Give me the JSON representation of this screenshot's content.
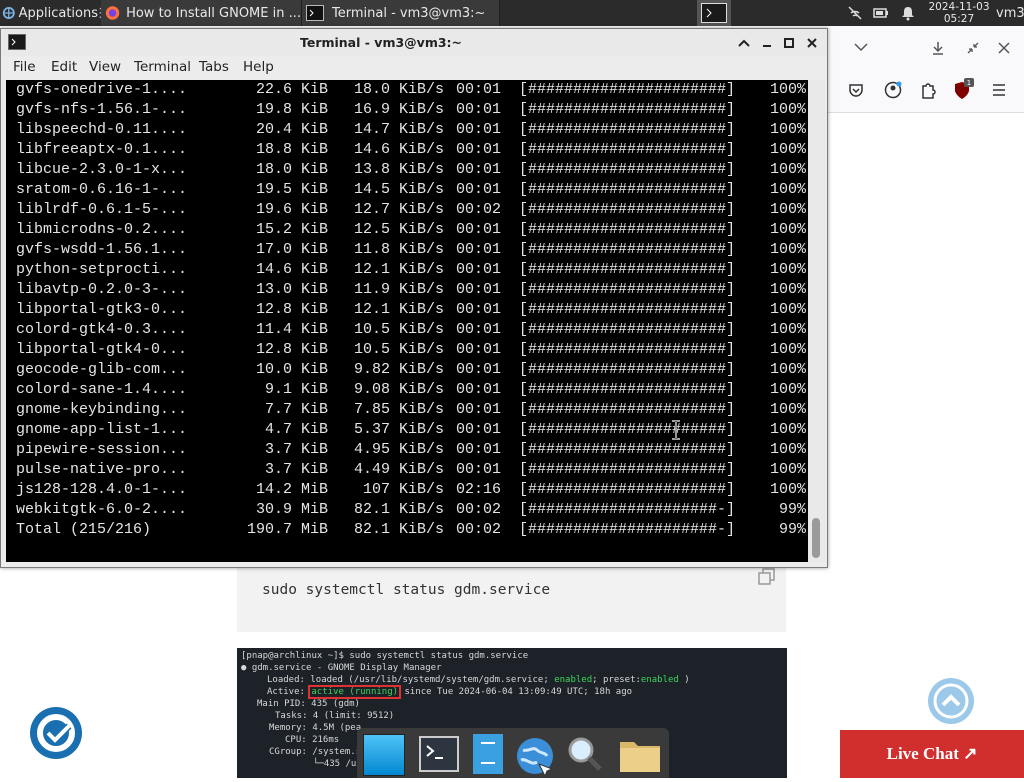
{
  "top_panel": {
    "applications_label": "Applications",
    "tasks": [
      {
        "label": "How to Install GNOME in ...",
        "icon": "firefox-icon"
      },
      {
        "label": "Terminal - vm3@vm3:~",
        "icon": "terminal-icon"
      }
    ],
    "clock_date": "2024-11-03",
    "clock_time": "05:27",
    "user": "vm3"
  },
  "terminal": {
    "title": "Terminal - vm3@vm3:~",
    "menu": [
      "File",
      "Edit",
      "View",
      "Terminal",
      "Tabs",
      "Help"
    ],
    "rows": [
      {
        "name": "gvfs-onedrive-1....",
        "size": "22.6 KiB",
        "speed": "18.0 KiB/s",
        "time": "00:01",
        "bar": "[######################]",
        "pct": "100%"
      },
      {
        "name": "gvfs-nfs-1.56.1-...",
        "size": "19.8 KiB",
        "speed": "16.9 KiB/s",
        "time": "00:01",
        "bar": "[######################]",
        "pct": "100%"
      },
      {
        "name": "libspeechd-0.11....",
        "size": "20.4 KiB",
        "speed": "14.7 KiB/s",
        "time": "00:01",
        "bar": "[######################]",
        "pct": "100%"
      },
      {
        "name": "libfreeaptx-0.1....",
        "size": "18.8 KiB",
        "speed": "14.6 KiB/s",
        "time": "00:01",
        "bar": "[######################]",
        "pct": "100%"
      },
      {
        "name": "libcue-2.3.0-1-x...",
        "size": "18.0 KiB",
        "speed": "13.8 KiB/s",
        "time": "00:01",
        "bar": "[######################]",
        "pct": "100%"
      },
      {
        "name": "sratom-0.6.16-1-...",
        "size": "19.5 KiB",
        "speed": "14.5 KiB/s",
        "time": "00:01",
        "bar": "[######################]",
        "pct": "100%"
      },
      {
        "name": "liblrdf-0.6.1-5-...",
        "size": "19.6 KiB",
        "speed": "12.7 KiB/s",
        "time": "00:02",
        "bar": "[######################]",
        "pct": "100%"
      },
      {
        "name": "libmicrodns-0.2....",
        "size": "15.2 KiB",
        "speed": "12.5 KiB/s",
        "time": "00:01",
        "bar": "[######################]",
        "pct": "100%"
      },
      {
        "name": "gvfs-wsdd-1.56.1...",
        "size": "17.0 KiB",
        "speed": "11.8 KiB/s",
        "time": "00:01",
        "bar": "[######################]",
        "pct": "100%"
      },
      {
        "name": "python-setprocti...",
        "size": "14.6 KiB",
        "speed": "12.1 KiB/s",
        "time": "00:01",
        "bar": "[######################]",
        "pct": "100%"
      },
      {
        "name": "libavtp-0.2.0-3-...",
        "size": "13.0 KiB",
        "speed": "11.9 KiB/s",
        "time": "00:01",
        "bar": "[######################]",
        "pct": "100%"
      },
      {
        "name": "libportal-gtk3-0...",
        "size": "12.8 KiB",
        "speed": "12.1 KiB/s",
        "time": "00:01",
        "bar": "[######################]",
        "pct": "100%"
      },
      {
        "name": "colord-gtk4-0.3....",
        "size": "11.4 KiB",
        "speed": "10.5 KiB/s",
        "time": "00:01",
        "bar": "[######################]",
        "pct": "100%"
      },
      {
        "name": "libportal-gtk4-0...",
        "size": "12.8 KiB",
        "speed": "10.5 KiB/s",
        "time": "00:01",
        "bar": "[######################]",
        "pct": "100%"
      },
      {
        "name": "geocode-glib-com...",
        "size": "10.0 KiB",
        "speed": "9.82 KiB/s",
        "time": "00:01",
        "bar": "[######################]",
        "pct": "100%"
      },
      {
        "name": "colord-sane-1.4....",
        "size": "9.1 KiB",
        "speed": "9.08 KiB/s",
        "time": "00:01",
        "bar": "[######################]",
        "pct": "100%"
      },
      {
        "name": "gnome-keybinding...",
        "size": "7.7 KiB",
        "speed": "7.85 KiB/s",
        "time": "00:01",
        "bar": "[######################]",
        "pct": "100%"
      },
      {
        "name": "gnome-app-list-1...",
        "size": "4.7 KiB",
        "speed": "5.37 KiB/s",
        "time": "00:01",
        "bar": "[######################]",
        "pct": "100%"
      },
      {
        "name": "pipewire-session...",
        "size": "3.7 KiB",
        "speed": "4.95 KiB/s",
        "time": "00:01",
        "bar": "[######################]",
        "pct": "100%"
      },
      {
        "name": "pulse-native-pro...",
        "size": "3.7 KiB",
        "speed": "4.49 KiB/s",
        "time": "00:01",
        "bar": "[######################]",
        "pct": "100%"
      },
      {
        "name": "js128-128.4.0-1-...",
        "size": "14.2 MiB",
        "speed": "107 KiB/s",
        "time": "02:16",
        "bar": "[######################]",
        "pct": "100%"
      },
      {
        "name": "webkitgtk-6.0-2....",
        "size": "30.9 MiB",
        "speed": "82.1 KiB/s",
        "time": "00:02",
        "bar": "[#####################-]",
        "pct": "99%"
      },
      {
        "name": "Total (215/216)",
        "size": "190.7 MiB",
        "speed": "82.1 KiB/s",
        "time": "00:02",
        "bar": "[#####################-]",
        "pct": "99%"
      }
    ]
  },
  "page": {
    "code_command": "sudo systemctl status gdm.service",
    "snippet": {
      "prompt": "[pnap@archlinux ~]$ sudo systemctl status gdm.service",
      "unit": "● gdm.service - GNOME Display Manager",
      "loaded_label": "Loaded:",
      "loaded_value": "loaded (/usr/lib/systemd/system/gdm.service;",
      "loaded_enabled": "enabled",
      "loaded_preset": "; preset:",
      "loaded_preset_value": "enabled",
      "active_label": "Active:",
      "active_value": "active (running)",
      "active_since": "since Tue 2024-06-04 13:09:49 UTC; 18h ago",
      "pid": "Main PID: 435 (gdm)",
      "tasks": "Tasks: 4 (limit: 9512)",
      "memory": "Memory: 4.5M (pea",
      "cpu": "CPU: 216ms",
      "cgroup": "CGroup: /system.s",
      "cgroup2": "└─435 /u"
    },
    "live_chat_label": "Live Chat ↗"
  },
  "colors": {
    "accent_red": "#d12e2e",
    "scroll_top_blue": "#9cc8ea",
    "green": "#3bd65c"
  }
}
